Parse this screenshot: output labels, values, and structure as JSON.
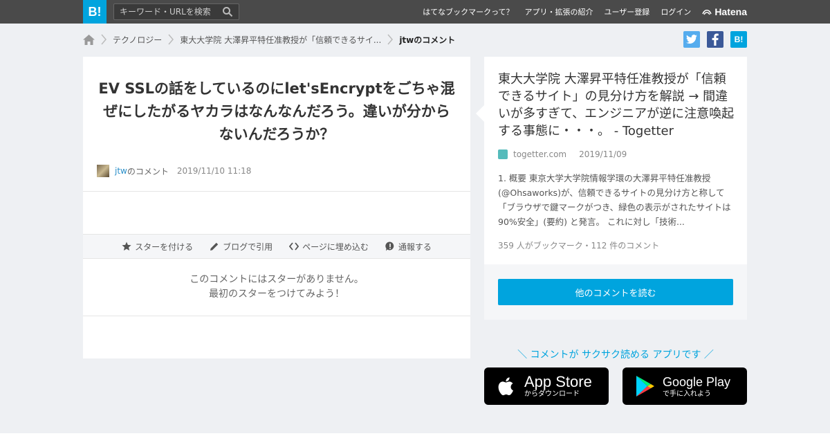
{
  "header": {
    "logo": "B!",
    "search_placeholder": "キーワード・URLを検索",
    "nav": [
      "はてなブックマークって？",
      "アプリ・拡張の紹介",
      "ユーザー登録",
      "ログイン"
    ],
    "brand": "Hatena"
  },
  "breadcrumb": {
    "items": [
      "テクノロジー",
      "東大大学院 大澤昇平特任准教授が「信頼できるサイ..."
    ],
    "current": "jtwのコメント"
  },
  "share": {
    "twitter": "t",
    "facebook": "f",
    "hatebu": "B!"
  },
  "comment": {
    "text": "EV SSLの話をしているのにlet'sEncryptをごちゃ混ぜにしたがるヤカラはなんなんだろう。違いが分からないんだろうか？",
    "user": "jtw",
    "user_suffix": "のコメント",
    "date": "2019/11/10 11:18"
  },
  "actions": [
    "スターを付ける",
    "ブログで引用",
    "ページに埋め込む",
    "通報する"
  ],
  "nostar": [
    "このコメントにはスターがありません。",
    "最初のスターをつけてみよう！"
  ],
  "entry": {
    "title": "東大大学院 大澤昇平特任准教授が「信頼できるサイト」の見分け方を解説 → 間違いが多すぎて、エンジニアが逆に注意喚起する事態に・・・。 - Togetter",
    "domain": "togetter.com",
    "date": "2019/11/09",
    "summary": "1. 概要 東京大学大学院情報学環の大澤昇平特任准教授(@Ohsaworks)が、信頼できるサイトの見分け方と称して「ブラウザで鍵マークがつき、緑色の表示がされたサイトは90%安全」(要約) と発言。 これに対し「技術...",
    "counts": "359 人がブックマーク・112 件のコメント",
    "read_button": "他のコメントを読む"
  },
  "promo": {
    "text": "＼ コメントが サクサク読める アプリです ／",
    "appstore_name": "App Store",
    "appstore_sub": "からダウンロード",
    "googleplay_name": "Google Play",
    "googleplay_sub": "で手に入れよう"
  }
}
